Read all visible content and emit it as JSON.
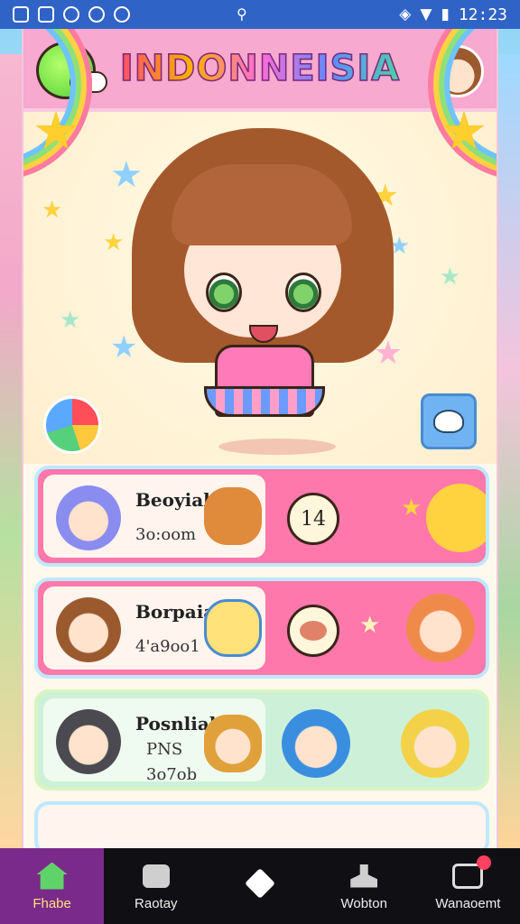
{
  "status_bar": {
    "time": "12:23"
  },
  "header": {
    "title": "INDONNEISIA"
  },
  "cards": [
    {
      "title": "Beoyiale",
      "subtitle": "3o:oom",
      "badge": "14"
    },
    {
      "title": "Borpaial",
      "subtitle": "4'a9oo1"
    },
    {
      "title": "Posnlial",
      "line2": "PNS",
      "line3": "3o7ob"
    }
  ],
  "bottom_nav": [
    {
      "label": "Fhabe",
      "icon": "home-icon",
      "active": true
    },
    {
      "label": "Raotay",
      "icon": "puzzle-icon"
    },
    {
      "label": "",
      "icon": "box-icon"
    },
    {
      "label": "Wobton",
      "icon": "lamp-icon"
    },
    {
      "label": "Wanaoemt",
      "icon": "tv-icon"
    }
  ],
  "colors": {
    "status_bar": "#2f63c6",
    "header": "#f7a9cf",
    "card_pink": "#ff78ab",
    "card_green": "#cdf1d8",
    "nav_active": "#7a2a8a"
  }
}
